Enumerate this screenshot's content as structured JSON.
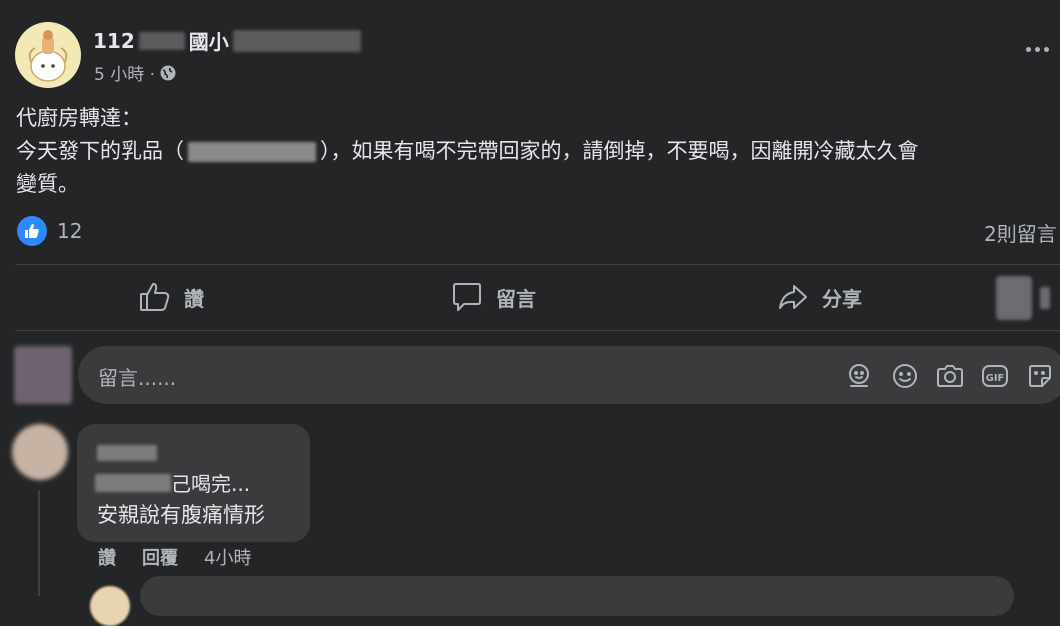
{
  "post": {
    "author_prefix": "112",
    "author_mid": "國小",
    "timestamp": "5 小時 ·",
    "line1": "代廚房轉達：",
    "line2_start": "今天發下的乳品（",
    "line2_end": "），如果有喝不完帶回家的，請倒掉，不要喝，因離開冷藏太久會",
    "line3": "變質。",
    "like_count": "12",
    "comment_count": "2則留言",
    "more_icon": "more-dots-icon"
  },
  "actions": {
    "like_label": "讚",
    "comment_label": "留言",
    "share_label": "分享"
  },
  "composer": {
    "placeholder": "留言......",
    "icons": [
      "avatar-sticker-icon",
      "emoji-icon",
      "camera-icon",
      "gif-icon",
      "sticker-icon"
    ]
  },
  "comment": {
    "text_line1": "己喝完...",
    "text_line2": "安親說有腹痛情形",
    "like_label": "讚",
    "reply_label": "回覆",
    "time": "4小時"
  },
  "colors": {
    "background": "#242526",
    "bubble": "#3a3b3c",
    "text": "#e4e6eb",
    "muted": "#b0b3b8",
    "like_blue": "#2d88ff"
  }
}
